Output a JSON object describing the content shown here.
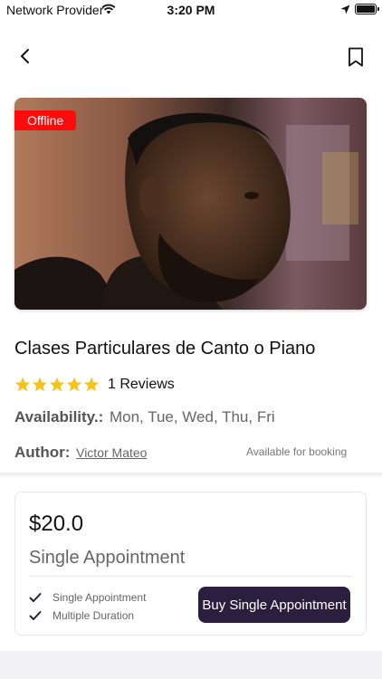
{
  "status_bar": {
    "carrier": "Network Provider",
    "time": "3:20 PM"
  },
  "course": {
    "badge": "Offline",
    "title": "Clases Particulares de Canto o Piano",
    "rating": 5,
    "reviews": "1 Reviews",
    "availability_label": "Availability.:",
    "availability_value": "Mon, Tue, Wed, Thu, Fri",
    "author_label": "Author:",
    "author_name": "Victor Mateo",
    "booking_status": "Available for booking"
  },
  "plan": {
    "price": "$20.0",
    "name": "Single Appointment",
    "features": [
      "Single Appointment",
      "Multiple Duration"
    ],
    "buy_label": "Buy Single Appointment"
  },
  "colors": {
    "badge": "#ff0b0b",
    "star": "#f7c31a",
    "button": "#2b1f3f"
  },
  "icons": {
    "back": "chevron-left-icon",
    "bookmark": "bookmark-icon",
    "check": "checkmark-icon"
  }
}
